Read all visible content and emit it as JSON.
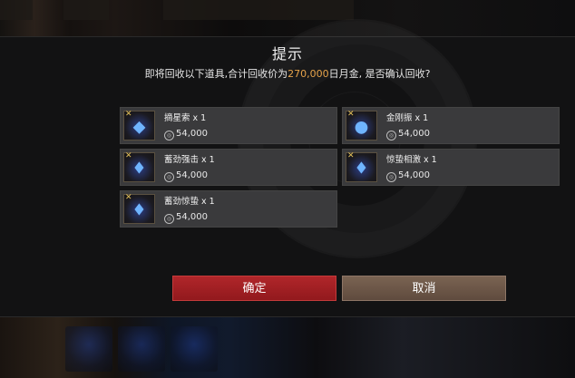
{
  "dialog": {
    "title": "提示",
    "message_prefix": "即将回收以下道具,合计回收价为",
    "total_amount": "270,000",
    "message_suffix": "日月金, 是否确认回收?"
  },
  "items": [
    {
      "name": "摘星索 x 1",
      "price": "54,000",
      "icon": "blue-crystal-cluster-icon"
    },
    {
      "name": "金刚振 x 1",
      "price": "54,000",
      "icon": "blue-dragon-orb-icon"
    },
    {
      "name": "蓄劲强击 x 1",
      "price": "54,000",
      "icon": "blue-crystal-shard-icon"
    },
    {
      "name": "惊蛰相激 x 1",
      "price": "54,000",
      "icon": "blue-crystal-shard-icon"
    },
    {
      "name": "蓄劲惊蛰 x 1",
      "price": "54,000",
      "icon": "blue-crystal-shard-icon"
    }
  ],
  "buttons": {
    "confirm": "确定",
    "cancel": "取消"
  },
  "colors": {
    "accent_amount": "#e6a34a",
    "confirm_button": "#a3222a",
    "cancel_button": "#6b5546"
  }
}
